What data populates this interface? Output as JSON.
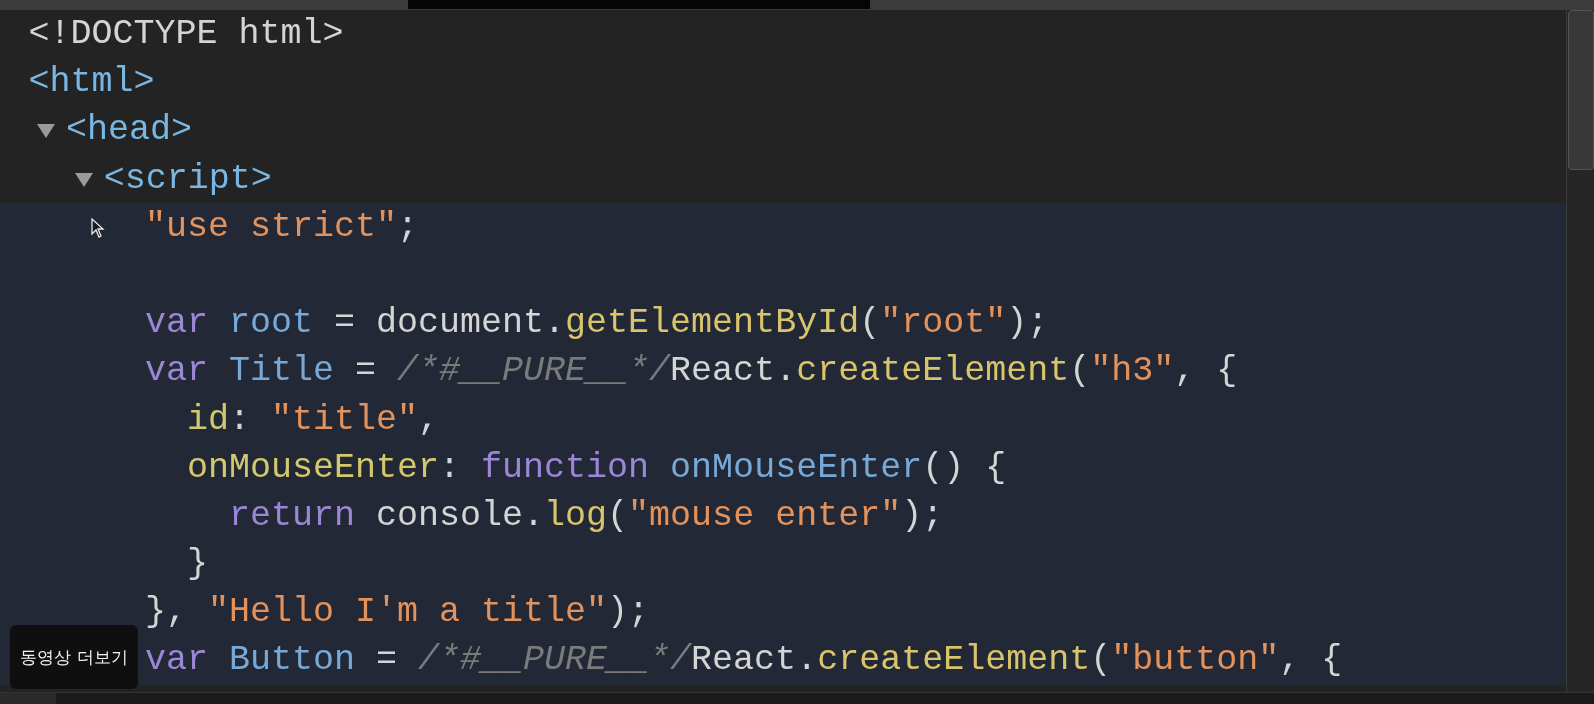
{
  "tree": [
    {
      "text": "<!DOCTYPE html>",
      "kind": "doctype"
    },
    {
      "text": "<html>",
      "kind": "tag",
      "children": [
        {
          "text": "<head>",
          "kind": "tag",
          "expanded": true,
          "children": [
            {
              "text": "<script>",
              "kind": "tag",
              "expanded": true,
              "selected": true,
              "lines": [
                {
                  "kind": "code",
                  "tokens": [
                    {
                      "t": "\"use strict\"",
                      "kind": "string"
                    },
                    {
                      "t": ";",
                      "kind": "plain"
                    }
                  ]
                },
                {
                  "kind": "blank"
                },
                {
                  "kind": "code",
                  "tokens": [
                    {
                      "t": "var",
                      "kind": "keyword"
                    },
                    {
                      "t": " root",
                      "kind": "ident"
                    },
                    {
                      "t": " = ",
                      "kind": "plain"
                    },
                    {
                      "t": "document.",
                      "kind": "plain"
                    },
                    {
                      "t": "getElementById",
                      "kind": "method"
                    },
                    {
                      "t": "(",
                      "kind": "plain"
                    },
                    {
                      "t": "\"root\"",
                      "kind": "string"
                    },
                    {
                      "t": ");",
                      "kind": "plain"
                    }
                  ]
                },
                {
                  "kind": "code",
                  "tokens": [
                    {
                      "t": "var",
                      "kind": "keyword"
                    },
                    {
                      "t": " Title",
                      "kind": "ident"
                    },
                    {
                      "t": " = ",
                      "kind": "plain"
                    },
                    {
                      "t": "/*#__PURE__*/",
                      "kind": "comment"
                    },
                    {
                      "t": "React.",
                      "kind": "plain"
                    },
                    {
                      "t": "createElement",
                      "kind": "method"
                    },
                    {
                      "t": "(",
                      "kind": "plain"
                    },
                    {
                      "t": "\"h3\"",
                      "kind": "string"
                    },
                    {
                      "t": ", {",
                      "kind": "plain"
                    }
                  ]
                },
                {
                  "kind": "code",
                  "tokens": [
                    {
                      "t": "  id",
                      "kind": "prop"
                    },
                    {
                      "t": ": ",
                      "kind": "plain"
                    },
                    {
                      "t": "\"title\"",
                      "kind": "string"
                    },
                    {
                      "t": ",",
                      "kind": "plain"
                    }
                  ]
                },
                {
                  "kind": "code",
                  "tokens": [
                    {
                      "t": "  onMouseEnter",
                      "kind": "prop"
                    },
                    {
                      "t": ": ",
                      "kind": "plain"
                    },
                    {
                      "t": "function",
                      "kind": "keyword"
                    },
                    {
                      "t": " onMouseEnter",
                      "kind": "ident"
                    },
                    {
                      "t": "() {",
                      "kind": "plain"
                    }
                  ]
                },
                {
                  "kind": "code",
                  "tokens": [
                    {
                      "t": "    return",
                      "kind": "keyword"
                    },
                    {
                      "t": " console.",
                      "kind": "plain"
                    },
                    {
                      "t": "log",
                      "kind": "method"
                    },
                    {
                      "t": "(",
                      "kind": "plain"
                    },
                    {
                      "t": "\"mouse enter\"",
                      "kind": "string"
                    },
                    {
                      "t": ");",
                      "kind": "plain"
                    }
                  ]
                },
                {
                  "kind": "code",
                  "tokens": [
                    {
                      "t": "  }",
                      "kind": "plain"
                    }
                  ]
                },
                {
                  "kind": "code",
                  "tokens": [
                    {
                      "t": "}, ",
                      "kind": "plain"
                    },
                    {
                      "t": "\"Hello I'm a title\"",
                      "kind": "string"
                    },
                    {
                      "t": ");",
                      "kind": "plain"
                    }
                  ]
                },
                {
                  "kind": "code",
                  "tokens": [
                    {
                      "t": "var",
                      "kind": "keyword"
                    },
                    {
                      "t": " Button",
                      "kind": "ident"
                    },
                    {
                      "t": " = ",
                      "kind": "plain"
                    },
                    {
                      "t": "/*#__PURE__*/",
                      "kind": "comment"
                    },
                    {
                      "t": "React.",
                      "kind": "plain"
                    },
                    {
                      "t": "createElement",
                      "kind": "method"
                    },
                    {
                      "t": "(",
                      "kind": "plain"
                    },
                    {
                      "t": "\"button\"",
                      "kind": "string"
                    },
                    {
                      "t": ", {",
                      "kind": "plain"
                    }
                  ]
                }
              ]
            }
          ]
        }
      ]
    }
  ],
  "overlay": {
    "label": "동영상 더보기"
  }
}
